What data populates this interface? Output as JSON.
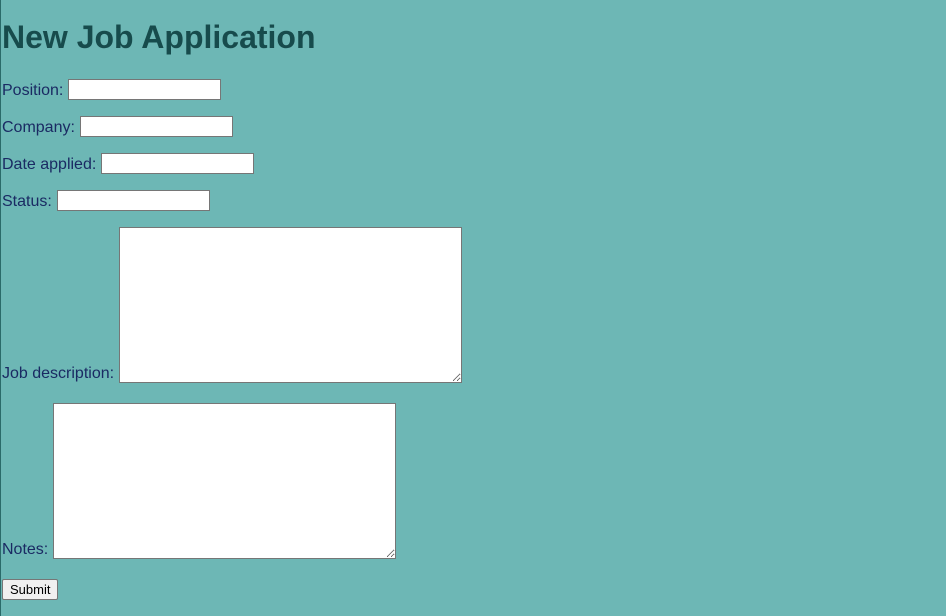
{
  "page": {
    "title": "New Job Application"
  },
  "form": {
    "fields": [
      {
        "label": "Position:",
        "value": "",
        "placeholder": ""
      },
      {
        "label": "Company:",
        "value": "",
        "placeholder": ""
      },
      {
        "label": "Date applied:",
        "value": "",
        "placeholder": ""
      },
      {
        "label": "Status:",
        "value": "",
        "placeholder": ""
      }
    ],
    "textareas": [
      {
        "label": "Job description:",
        "value": ""
      },
      {
        "label": "Notes:",
        "value": ""
      }
    ],
    "submit_label": "Submit"
  },
  "colors": {
    "background": "#6db7b5",
    "title": "#174b4c",
    "label": "#1a2a63"
  }
}
